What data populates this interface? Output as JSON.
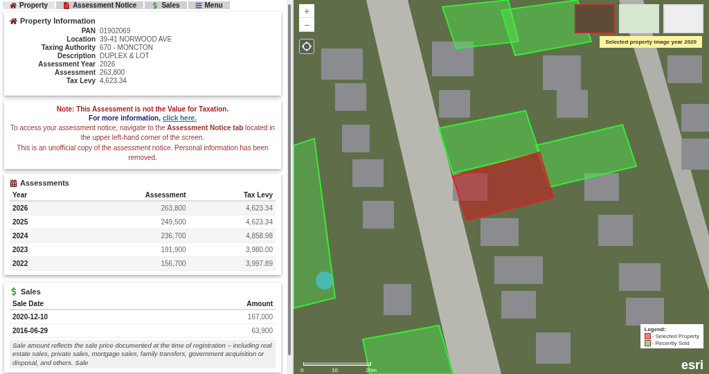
{
  "tabs": [
    {
      "label": "Property",
      "kind": "home",
      "selected": true
    },
    {
      "label": "Assessment Notice",
      "kind": "notice",
      "selected": false
    },
    {
      "label": "Sales",
      "kind": "sales",
      "selected": false
    },
    {
      "label": "Menu",
      "kind": "menu",
      "selected": false
    }
  ],
  "property_information": {
    "title": "Property Information",
    "fields": [
      {
        "label": "PAN",
        "value": "01902069"
      },
      {
        "label": "Location",
        "value": "39-41 NORWOOD AVE"
      },
      {
        "label": "Taxing Authority",
        "value": "670 - MONCTON"
      },
      {
        "label": "Description",
        "value": "DUPLEX & LOT"
      },
      {
        "label": "Assessment Year",
        "value": "2026"
      },
      {
        "label": "Assessment",
        "value": "263,800"
      },
      {
        "label": "Tax Levy",
        "value": "4,623.34"
      }
    ]
  },
  "notice": {
    "heading": "Note: This Assessment is not the Value for Taxation.",
    "more_info": "For more information,",
    "link": "click here.",
    "instructions": "To access your assessment notice, navigate to the **Assessment Notice tab** located in the upper left-hand corner of the screen.",
    "disclaimer": "This is an unofficial copy of the assessment notice. Personal information has been removed."
  },
  "assessments": {
    "title": "Assessments",
    "columns": [
      "Year",
      "Assessment",
      "Tax Levy"
    ],
    "rows": [
      [
        "2026",
        "263,800",
        "4,623.34"
      ],
      [
        "2025",
        "249,500",
        "4,623.34"
      ],
      [
        "2024",
        "236,700",
        "4,858.98"
      ],
      [
        "2023",
        "191,900",
        "3,980.00"
      ],
      [
        "2022",
        "156,700",
        "3,997.89"
      ]
    ]
  },
  "sales": {
    "title": "Sales",
    "columns": [
      "Sale Date",
      "Amount"
    ],
    "rows": [
      [
        "2020-12-10",
        "167,000"
      ],
      [
        "2016-06-29",
        "63,900"
      ]
    ],
    "note": "Sale amount reflects the sale price documented at the time of registration – including real estate sales, private sales, mortgage sales, family transfers, government acquisition or disposal, and others. Sale"
  },
  "map": {
    "zoom_in": "+",
    "zoom_out": "−",
    "basemaps": [
      {
        "kind": "imagery",
        "selected": true
      },
      {
        "kind": "topo",
        "selected": false
      },
      {
        "kind": "gray",
        "selected": false
      }
    ],
    "tooltip": "Selected property image year 2020",
    "legend": {
      "title": "Legend:",
      "items": [
        {
          "label": "- Selected Property",
          "color": "#e88080"
        },
        {
          "label": "- Recently Sold",
          "color": "#80e080"
        }
      ]
    },
    "scale": [
      "0",
      "10",
      "20m"
    ],
    "logo": "esri"
  }
}
